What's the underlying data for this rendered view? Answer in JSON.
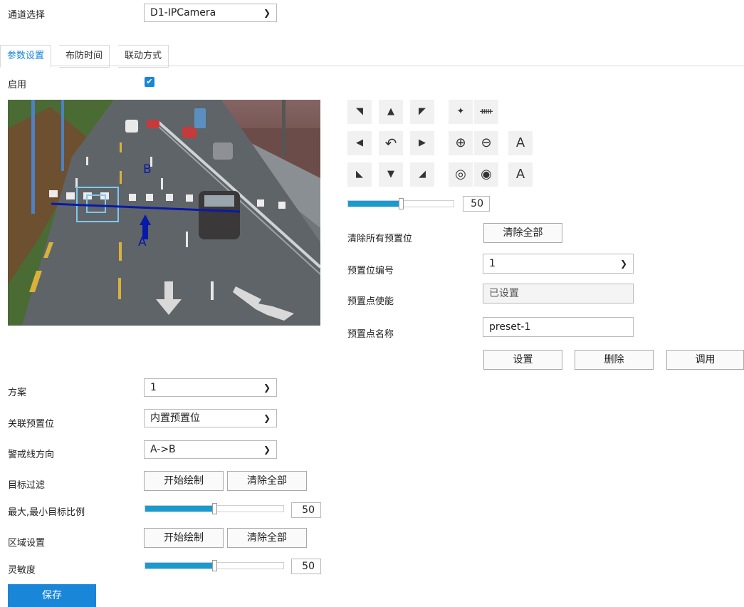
{
  "channel": {
    "label": "通道选择",
    "value": "D1-IPCamera"
  },
  "tabs": [
    "参数设置",
    "布防时间",
    "联动方式"
  ],
  "enable": {
    "label": "启用",
    "checked": true
  },
  "video": {
    "line_label_a": "A",
    "line_label_b": "B"
  },
  "ptz": {
    "buttons": [
      "◥",
      "▲",
      "◤",
      "✦",
      "ᚔ",
      "◀",
      "↶",
      "▶",
      "⊕",
      "⊖",
      "A",
      "◣",
      "▼",
      "◢",
      "◎",
      "◉",
      "A"
    ],
    "speed_value": "50",
    "speed_fraction": 0.5
  },
  "preset": {
    "clear_all_label": "清除所有预置位",
    "clear_all_button": "清除全部",
    "number_label": "预置位编号",
    "number_value": "1",
    "enable_label": "预置点使能",
    "enable_value": "已设置",
    "name_label": "预置点名称",
    "name_value": "preset-1",
    "set_button": "设置",
    "delete_button": "删除",
    "call_button": "调用"
  },
  "form": {
    "scheme_label": "方案",
    "scheme_value": "1",
    "assoc_preset_label": "关联预置位",
    "assoc_preset_value": "内置预置位",
    "direction_label": "警戒线方向",
    "direction_value": "A->B",
    "target_filter_label": "目标过滤",
    "start_draw_button": "开始绘制",
    "clear_all_button": "清除全部",
    "ratio_label": "最大,最小目标比例",
    "ratio_value": "50",
    "ratio_fraction": 0.5,
    "region_label": "区域设置",
    "region_start_button": "开始绘制",
    "region_clear_button": "清除全部",
    "sensitivity_label": "灵敏度",
    "sensitivity_value": "50",
    "sensitivity_fraction": 0.5,
    "save_button": "保存"
  },
  "colors": {
    "accent": "#1a9bd0",
    "save_bg": "#1a86d8",
    "tab_active": "#1a86d8",
    "line": "#0a1aa8"
  }
}
